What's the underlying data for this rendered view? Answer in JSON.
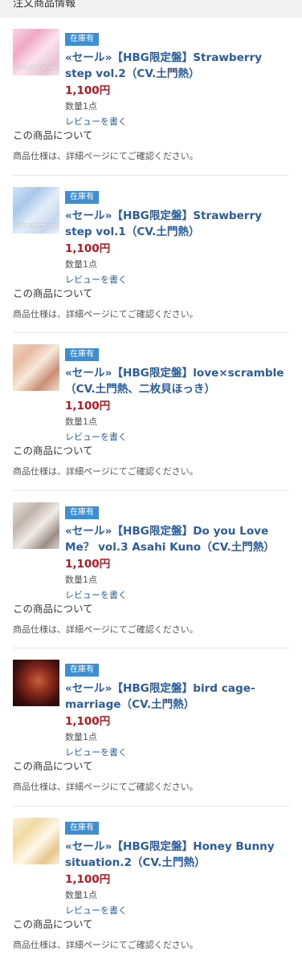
{
  "section": {
    "title": "注文商品情報"
  },
  "colors": {
    "badge": "#3d8fd1",
    "title_link": "#2a5d9e",
    "price": "#c0141c"
  },
  "items": [
    {
      "badge": "在庫有",
      "title": "«セール»【HBG限定盤】Strawberry step vol.2（CV.土門熱）",
      "price": "1,100円",
      "qty": "数量1点",
      "review": "レビューを書く",
      "about": "この商品について",
      "spec": "商品仕様は、詳細ページにてご確認ください。",
      "thumb_text": "Strawberry step"
    },
    {
      "badge": "在庫有",
      "title": "«セール»【HBG限定盤】Strawberry step vol.1（CV.土門熱）",
      "price": "1,100円",
      "qty": "数量1点",
      "review": "レビューを書く",
      "about": "この商品について",
      "spec": "商品仕様は、詳細ページにてご確認ください。",
      "thumb_text": "Strawberry step"
    },
    {
      "badge": "在庫有",
      "title": "«セール»【HBG限定盤】love×scramble（CV.土門熱、二枚貝ほっき）",
      "price": "1,100円",
      "qty": "数量1点",
      "review": "レビューを書く",
      "about": "この商品について",
      "spec": "商品仕様は、詳細ページにてご確認ください。",
      "thumb_text": ""
    },
    {
      "badge": "在庫有",
      "title": "«セール»【HBG限定盤】Do you Love Me？ vol.3 Asahi Kuno（CV.土門熱）",
      "price": "1,100円",
      "qty": "数量1点",
      "review": "レビューを書く",
      "about": "この商品について",
      "spec": "商品仕様は、詳細ページにてご確認ください。",
      "thumb_text": ""
    },
    {
      "badge": "在庫有",
      "title": "«セール»【HBG限定盤】bird cage-marriage（CV.土門熱）",
      "price": "1,100円",
      "qty": "数量1点",
      "review": "レビューを書く",
      "about": "この商品について",
      "spec": "商品仕様は、詳細ページにてご確認ください。",
      "thumb_text": ""
    },
    {
      "badge": "在庫有",
      "title": "«セール»【HBG限定盤】Honey Bunny situation.2（CV.土門熱）",
      "price": "1,100円",
      "qty": "数量1点",
      "review": "レビューを書く",
      "about": "この商品について",
      "spec": "商品仕様は、詳細ページにてご確認ください。",
      "thumb_text": ""
    }
  ]
}
